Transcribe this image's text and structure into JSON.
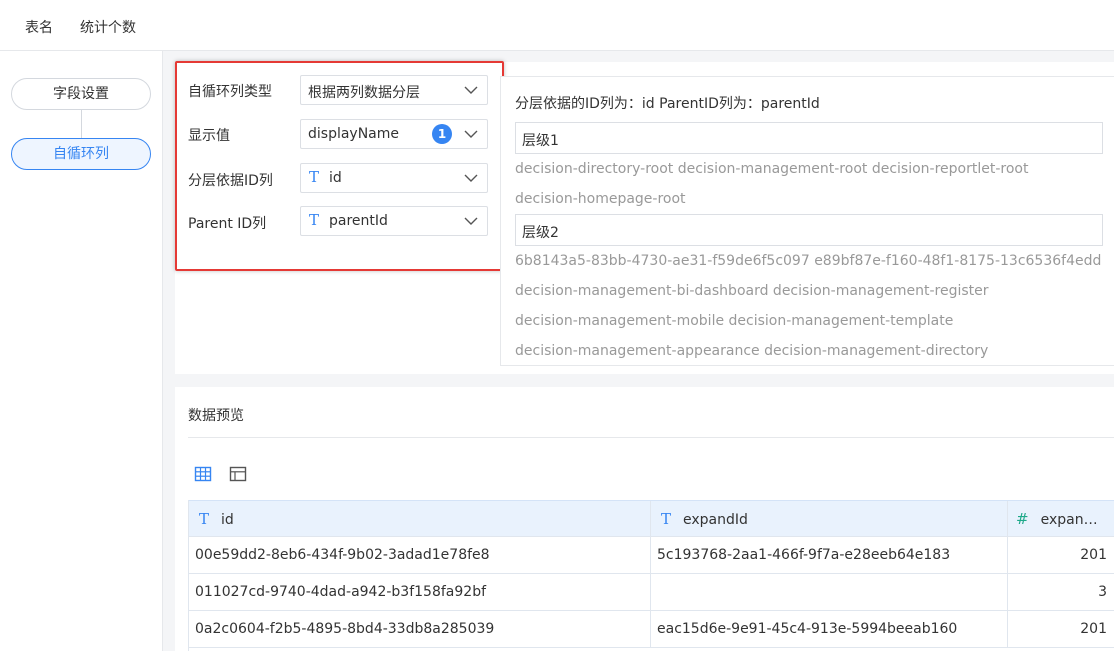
{
  "topbar": {
    "tabs": [
      "表名",
      "统计个数"
    ]
  },
  "steps": [
    "字段设置",
    "自循环列"
  ],
  "config": {
    "fields": [
      {
        "label": "自循环列类型",
        "value": "根据两列数据分层",
        "type_icon": ""
      },
      {
        "label": "显示值",
        "value": "displayName",
        "type_icon": "",
        "badge": "1"
      },
      {
        "label": "分层依据ID列",
        "value": "id",
        "type_icon": "T"
      },
      {
        "label": "Parent ID列",
        "value": "parentId",
        "type_icon": "T"
      }
    ]
  },
  "preview": {
    "heading": "分层依据的ID列为：id  ParentID列为：parentId",
    "levels": [
      {
        "name": "层级1",
        "lines": [
          "decision-directory-root  decision-management-root  decision-reportlet-root",
          "decision-homepage-root"
        ]
      },
      {
        "name": "层级2",
        "lines": [
          "6b8143a5-83bb-4730-ae31-f59de6f5c097  e89bf87e-f160-48f1-8175-13c6536f4edd",
          "decision-management-bi-dashboard  decision-management-register",
          "decision-management-mobile  decision-management-template",
          "decision-management-appearance  decision-management-directory"
        ]
      }
    ]
  },
  "data_preview": {
    "title": "数据预览",
    "view_icons": [
      "grid-view-icon",
      "panel-view-icon"
    ],
    "columns": [
      {
        "name": "id",
        "type_icon": "T"
      },
      {
        "name": "expandId",
        "type_icon": "T"
      },
      {
        "name": "expan…",
        "type_icon": "#"
      }
    ],
    "rows": [
      [
        "00e59dd2-8eb6-434f-9b02-3adad1e78fe8",
        "5c193768-2aa1-466f-9f7a-e28eeb64e183",
        "201"
      ],
      [
        "011027cd-9740-4dad-a942-b3f158fa92bf",
        "",
        "3"
      ],
      [
        "0a2c0604-f2b5-4895-8bd4-33db8a285039",
        "eac15d6e-9e91-45c4-913e-5994beeab160",
        "201"
      ]
    ]
  },
  "colors": {
    "accent": "#3685f2",
    "highlight": "#e53935",
    "number_type": "#1fa98a"
  }
}
